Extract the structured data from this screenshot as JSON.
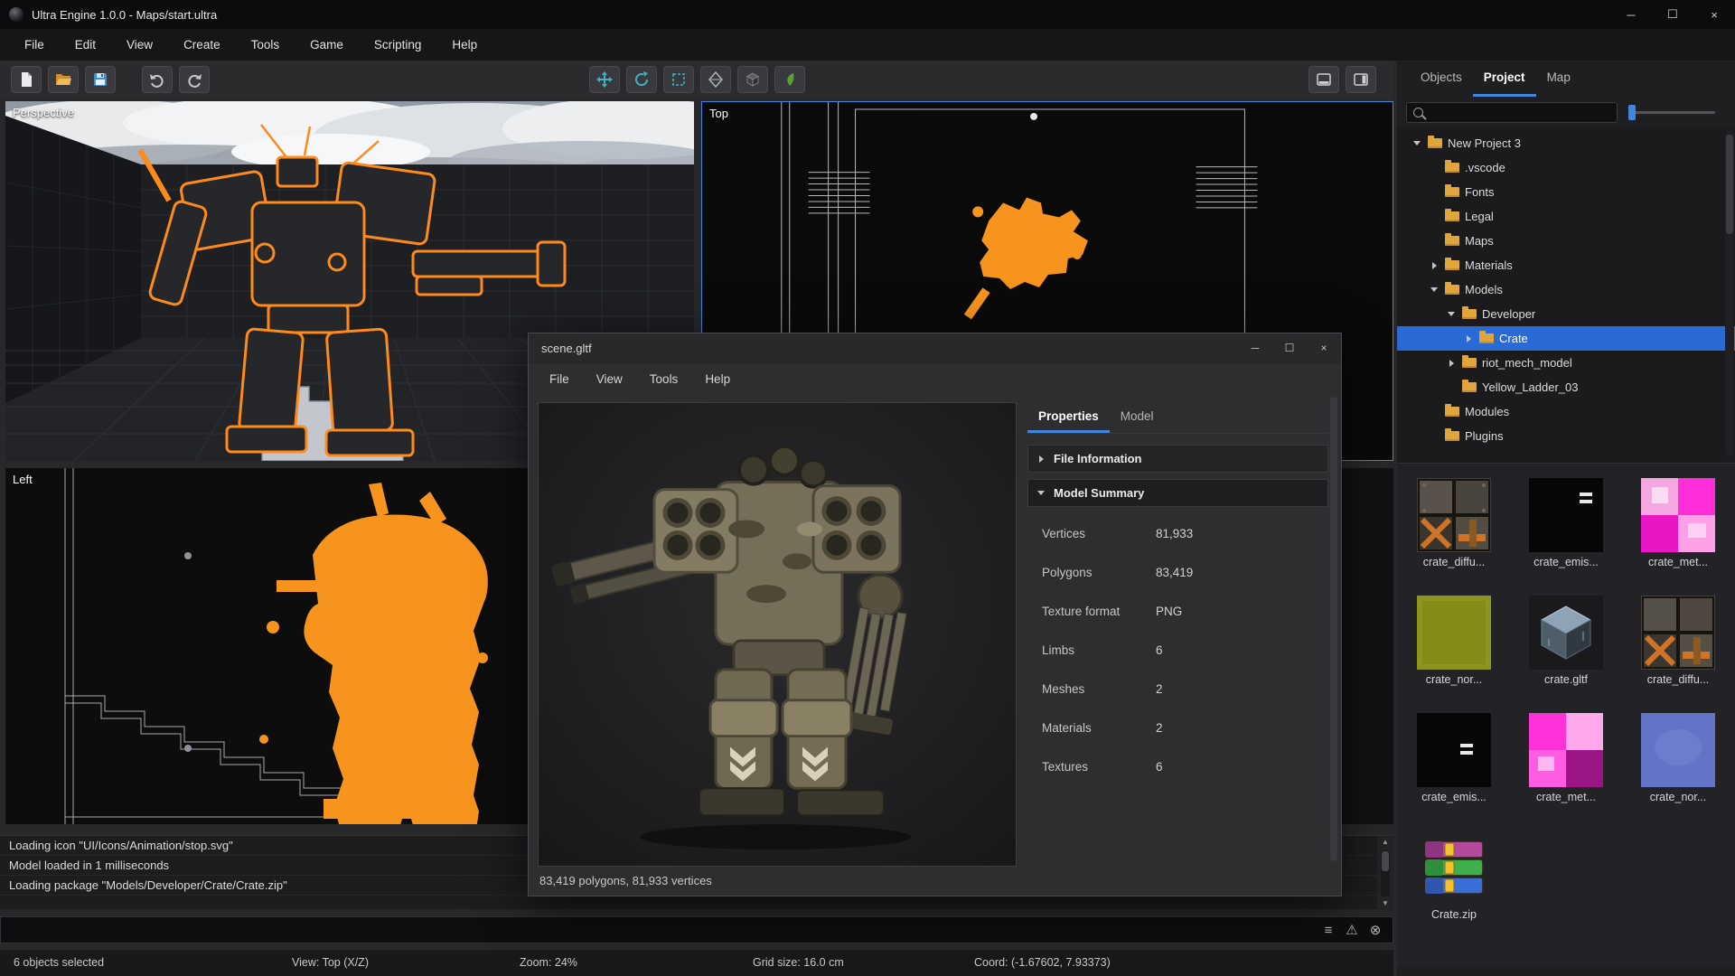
{
  "titlebar": {
    "title": "Ultra Engine 1.0.0 - Maps/start.ultra",
    "minimize": "─",
    "maximize": "☐",
    "close": "×"
  },
  "menubar": {
    "items": [
      "File",
      "Edit",
      "View",
      "Create",
      "Tools",
      "Game",
      "Scripting",
      "Help"
    ]
  },
  "toolbar": {
    "icons": [
      "new-file",
      "open-folder",
      "save",
      "undo",
      "redo",
      "move-tool",
      "rotate-tool",
      "box-select-tool",
      "face-tool",
      "cube-tool",
      "terrain-paint-tool",
      "layout-bottom-pane",
      "layout-right-pane"
    ]
  },
  "viewports": {
    "perspective": "Perspective",
    "top": "Top",
    "left": "Left"
  },
  "right_panel": {
    "tabs": {
      "objects": "Objects",
      "project": "Project",
      "map": "Map"
    },
    "active_tab": "Project",
    "tree": [
      {
        "label": "New Project 3",
        "level": 0,
        "state": "expanded"
      },
      {
        "label": ".vscode",
        "level": 1,
        "state": "none"
      },
      {
        "label": "Fonts",
        "level": 1,
        "state": "none"
      },
      {
        "label": "Legal",
        "level": 1,
        "state": "none"
      },
      {
        "label": "Maps",
        "level": 1,
        "state": "none"
      },
      {
        "label": "Materials",
        "level": 1,
        "state": "collapsed"
      },
      {
        "label": "Models",
        "level": 1,
        "state": "expanded"
      },
      {
        "label": "Developer",
        "level": 2,
        "state": "expanded"
      },
      {
        "label": "Crate",
        "level": 3,
        "state": "collapsed",
        "selected": true
      },
      {
        "label": "riot_mech_model",
        "level": 2,
        "state": "collapsed"
      },
      {
        "label": "Yellow_Ladder_03",
        "level": 2,
        "state": "none"
      },
      {
        "label": "Modules",
        "level": 1,
        "state": "none"
      },
      {
        "label": "Plugins",
        "level": 1,
        "state": "none"
      }
    ],
    "assets": [
      {
        "label": "crate_diffu...",
        "type": "texture-diffuse"
      },
      {
        "label": "crate_emis...",
        "type": "texture-emissive"
      },
      {
        "label": "crate_met...",
        "type": "texture-metal"
      },
      {
        "label": "crate_nor...",
        "type": "texture-normal-olive"
      },
      {
        "label": "crate.gltf",
        "type": "model"
      },
      {
        "label": "crate_diffu...",
        "type": "texture-diffuse"
      },
      {
        "label": "crate_emis...",
        "type": "texture-emissive"
      },
      {
        "label": "crate_met...",
        "type": "texture-metal"
      },
      {
        "label": "crate_nor...",
        "type": "texture-normal-blue"
      },
      {
        "label": "Crate.zip",
        "type": "archive"
      }
    ]
  },
  "model_window": {
    "title": "scene.gltf",
    "minimize": "─",
    "maximize": "☐",
    "close": "×",
    "menu": [
      "File",
      "View",
      "Tools",
      "Help"
    ],
    "tabs": {
      "properties": "Properties",
      "model": "Model"
    },
    "sections": [
      {
        "label": "File Information"
      },
      {
        "label": "Model Summary"
      }
    ],
    "properties": [
      {
        "label": "Vertices",
        "value": "81,933"
      },
      {
        "label": "Polygons",
        "value": "83,419"
      },
      {
        "label": "Texture format",
        "value": "PNG"
      },
      {
        "label": "Limbs",
        "value": "6"
      },
      {
        "label": "Meshes",
        "value": "2"
      },
      {
        "label": "Materials",
        "value": "2"
      },
      {
        "label": "Textures",
        "value": "6"
      }
    ],
    "status": "83,419 polygons, 81,933 vertices"
  },
  "console": {
    "lines": [
      "Loading icon \"UI/Icons/Animation/stop.svg\"",
      "Model loaded in 1 milliseconds",
      "Loading package \"Models/Developer/Crate/Crate.zip\""
    ]
  },
  "cmdbar": {
    "icons": {
      "list": "≡",
      "warning": "⚠",
      "clear": "⊗"
    }
  },
  "statusbar": {
    "selection": "6 objects selected",
    "view": "View: Top (X/Z)",
    "zoom": "Zoom: 24%",
    "grid": "Grid size: 16.0 cm",
    "coord": "Coord: (-1.67602, 7.93373)"
  },
  "colors": {
    "accent": "#3f86e0",
    "selection_orange": "#f7941d",
    "folder": "#e0a63c"
  }
}
